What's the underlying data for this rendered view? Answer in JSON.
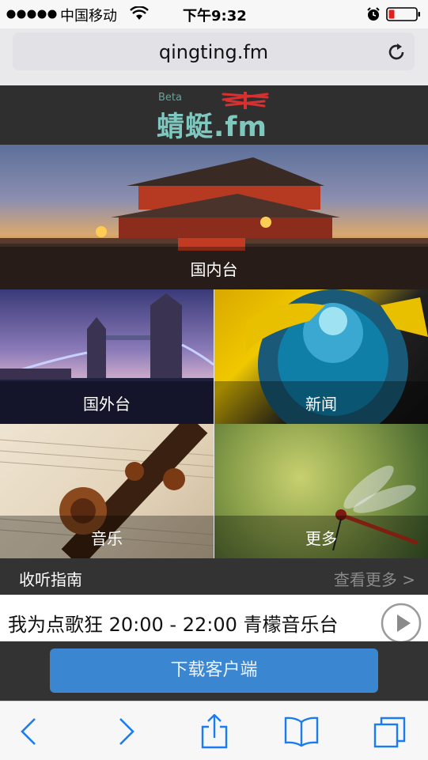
{
  "status": {
    "carrier": "中国移动",
    "time": "下午9:32"
  },
  "browser": {
    "url": "qingting.fm"
  },
  "site": {
    "logo_text": "蜻蜓.fm",
    "logo_tag": "Beta"
  },
  "tiles": {
    "domestic": "国内台",
    "foreign": "国外台",
    "news": "新闻",
    "music": "音乐",
    "more": "更多"
  },
  "guide": {
    "title": "收听指南",
    "more": "查看更多 >"
  },
  "now_playing": {
    "program": "我为点歌狂 20:00 - 22:00 青檬音乐台"
  },
  "download_label": "下载客户端",
  "colors": {
    "accent": "#3a86d0",
    "header_bg": "#2f2f2f",
    "logo_teal": "#7fc8c0",
    "logo_red": "#d83030"
  }
}
